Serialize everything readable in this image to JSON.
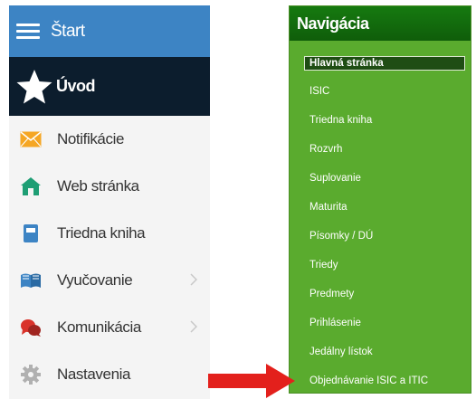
{
  "sidebar": {
    "start_label": "Štart",
    "uvod_label": "Úvod",
    "items": [
      {
        "label": "Notifikácie",
        "icon": "envelope-icon",
        "color": "#f5a623"
      },
      {
        "label": "Web stránka",
        "icon": "home-icon",
        "color": "#1e9e74"
      },
      {
        "label": "Triedna kniha",
        "icon": "book-icon",
        "color": "#3d84c4"
      },
      {
        "label": "Vyučovanie",
        "icon": "open-book-icon",
        "color": "#3d84c4"
      },
      {
        "label": "Komunikácia",
        "icon": "chat-icon",
        "color": "#d9332b"
      },
      {
        "label": "Nastavenia",
        "icon": "gear-icon",
        "color": "#b0b0b0"
      }
    ]
  },
  "nav": {
    "title": "Navigácia",
    "items": [
      "Hlavná stránka",
      "ISIC",
      "Triedna kniha",
      "Rozvrh",
      "Suplovanie",
      "Maturita",
      "Písomky / DÚ",
      "Triedy",
      "Predmety",
      "Prihlásenie",
      "Jedálny lístok",
      "Objednávanie ISIC a ITIC"
    ]
  },
  "colors": {
    "sidebar_header": "#3d84c4",
    "sidebar_active": "#0c1d2d",
    "nav_background": "#5aab2e",
    "nav_header": "#167a10",
    "arrow": "#e3201c"
  }
}
